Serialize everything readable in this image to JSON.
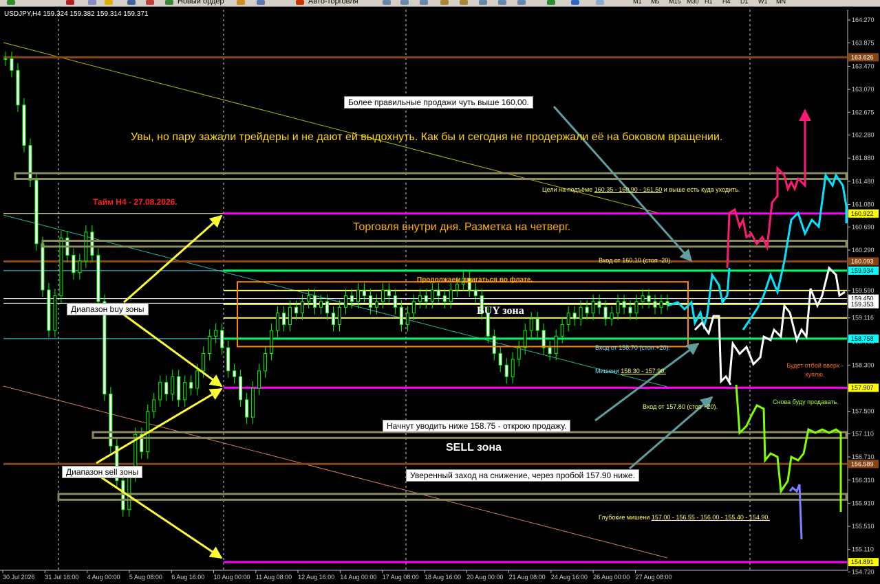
{
  "toolbar": {
    "new_order": "Новый ордер",
    "auto_trading": "Авто-торговля",
    "timeframes": [
      "M1",
      "M5",
      "M15",
      "M30",
      "H1",
      "H4",
      "D1",
      "W1",
      "MN"
    ]
  },
  "header": {
    "symbol": "USDJPY,H4",
    "ohlc": "159.324 159.382 159.314 159.371"
  },
  "colors": {
    "background": "#000000",
    "buy_zone": "#ff8c00",
    "magenta": "#ff00ff",
    "brown": "#8b4513",
    "olive": "#808060",
    "green": "#00ff00",
    "yellow": "#ffff00"
  },
  "annotations": {
    "title_time": "Тайм H4 - 27.08.2026.",
    "headline": "Увы, но пару зажали трейдеры и не дают ей выдохнуть. Как бы и сегодня не продержали её на боковом вращении.",
    "intraday": "Торговля внутри дня. Разметка на четверг.",
    "better_sells": "Более правильные продажи чуть выше 160.00.",
    "targets_up_prefix": "Цели на подъёме",
    "targets_up_values": "160.35 - 160.90 - 161.50",
    "targets_up_suffix": "и выше есть куда уходить.",
    "entry_1610": "Вход от 160.10 (стоп -20).",
    "flat": "Продолжаем двигаться во флэте.",
    "buy_zone": "BUY зона",
    "buy_range": "Диапазон buy зоны",
    "entry_1587": "Вход от 158.70 (стоп +20).",
    "targets_down_prefix": "Мишени",
    "targets_down_values": "158.30 - 157.90.",
    "bounce": "Будет отбой вверх - куплю.",
    "sell_again": "Снова буду продавать.",
    "entry_1578": "Вход от 157.80 (стоп +20).",
    "sell_below": "Начнут уводить ниже 158.75 - открою продажу.",
    "sell_zone": "SELL зона",
    "sell_range": "Диапазон sell зоны",
    "confident_sell": "Уверенный заход на снижение, через пробой 157.90 ниже.",
    "deep_prefix": "Глубокие мишени",
    "deep_values": "157.00 - 156.55 - 156.00 - 155.40 - 154.90."
  },
  "chart_data": {
    "type": "candlestick",
    "symbol": "USDJPY",
    "timeframe": "H4",
    "ylim": [
      154.75,
      164.45
    ],
    "y_ticks": [
      164.27,
      163.875,
      163.47,
      163.07,
      162.675,
      162.28,
      161.88,
      161.48,
      161.08,
      160.69,
      160.29,
      159.59,
      159.116,
      158.7,
      158.3,
      157.9,
      157.5,
      157.11,
      156.71,
      156.31,
      155.91,
      155.51,
      155.11,
      154.72
    ],
    "y_tick_labels": [
      "164.270",
      "163.875",
      "163.470",
      "163.070",
      "162.675",
      "162.280",
      "161.880",
      "161.480",
      "161.080",
      "160.690",
      "160.290",
      "159.590",
      "159.116",
      "158.700",
      "158.300",
      "157.900",
      "157.500",
      "157.110",
      "156.710",
      "156.310",
      "155.910",
      "155.510",
      "155.110",
      "154.720"
    ],
    "x_labels": [
      "30 Jul 2026",
      "31 Jul 16:00",
      "4 Aug 00:00",
      "5 Aug 08:00",
      "6 Aug 16:00",
      "10 Aug 00:00",
      "11 Aug 08:00",
      "12 Aug 16:00",
      "14 Aug 00:00",
      "17 Aug 08:00",
      "18 Aug 16:00",
      "20 Aug 00:00",
      "21 Aug 08:00",
      "24 Aug 16:00",
      "26 Aug 00:00",
      "27 Aug 08:00"
    ],
    "price_tags": [
      {
        "value": 163.626,
        "label": "163.626",
        "bg": "#8b4513",
        "fg": "#ffffff"
      },
      {
        "value": 160.922,
        "label": "160.922",
        "bg": "#ffff00",
        "fg": "#000000"
      },
      {
        "value": 160.093,
        "label": "160.093",
        "bg": "#8b4513",
        "fg": "#ffffff"
      },
      {
        "value": 159.934,
        "label": "159.934",
        "bg": "#00ffff",
        "fg": "#000000"
      },
      {
        "value": 159.45,
        "label": "159.450",
        "bg": "#ffffff",
        "fg": "#000000"
      },
      {
        "value": 159.353,
        "label": "159.353",
        "bg": "#ffffff",
        "fg": "#000000"
      },
      {
        "value": 158.758,
        "label": "158.758",
        "bg": "#00ffff",
        "fg": "#000000"
      },
      {
        "value": 157.907,
        "label": "157.907",
        "bg": "#ffff00",
        "fg": "#000000"
      },
      {
        "value": 156.589,
        "label": "156.589",
        "bg": "#8b4513",
        "fg": "#ffffff"
      },
      {
        "value": 154.891,
        "label": "154.891",
        "bg": "#ffff00",
        "fg": "#000000"
      }
    ],
    "levels": [
      {
        "value": 163.626,
        "color": "#8b4513",
        "width": 3
      },
      {
        "value": 160.922,
        "color": "#ff00ff",
        "width": 3
      },
      {
        "value": 160.093,
        "color": "#8b4513",
        "width": 3
      },
      {
        "value": 159.934,
        "color": "#00ff66",
        "width": 3
      },
      {
        "value": 159.59,
        "color": "#ffff66",
        "width": 2
      },
      {
        "value": 159.353,
        "color": "#ffff66",
        "width": 2
      },
      {
        "value": 159.116,
        "color": "#ffff66",
        "width": 2
      },
      {
        "value": 158.758,
        "color": "#00ff66",
        "width": 3
      },
      {
        "value": 157.907,
        "color": "#ff00ff",
        "width": 3
      },
      {
        "value": 156.589,
        "color": "#8b4513",
        "width": 3
      },
      {
        "value": 154.891,
        "color": "#ff00ff",
        "width": 3
      }
    ],
    "close_series": [
      163.6,
      163.4,
      162.8,
      162.1,
      161.5,
      160.4,
      159.6,
      158.9,
      159.5,
      160.5,
      160.2,
      159.9,
      160.1,
      160.6,
      160.2,
      159.4,
      157.8,
      156.9,
      156.3,
      155.8,
      156.4,
      157.1,
      156.8,
      157.5,
      157.7,
      158.0,
      157.8,
      158.1,
      157.7,
      158.0,
      157.9,
      158.2,
      158.5,
      158.8,
      158.9,
      158.6,
      158.2,
      158.1,
      157.7,
      157.4,
      157.9,
      158.2,
      158.5,
      158.9,
      159.2,
      159.0,
      159.3,
      159.2,
      159.4,
      159.5,
      159.3,
      159.4,
      159.2,
      159.0,
      159.3,
      159.5,
      159.4,
      159.6,
      159.5,
      159.3,
      159.4,
      159.6,
      159.5,
      159.3,
      159.0,
      159.2,
      159.4,
      159.5,
      159.4,
      159.6,
      159.5,
      159.4,
      159.6,
      159.7,
      159.8,
      159.6,
      159.5,
      159.2,
      158.8,
      158.5,
      158.3,
      158.1,
      158.4,
      158.6,
      158.9,
      159.1,
      158.9,
      158.6,
      158.5,
      158.8,
      159.0,
      159.2,
      159.1,
      159.3,
      159.2,
      159.4,
      159.3,
      159.1,
      159.2,
      159.4,
      159.3,
      159.2,
      159.4,
      159.5,
      159.4,
      159.3,
      159.4,
      159.37
    ]
  }
}
